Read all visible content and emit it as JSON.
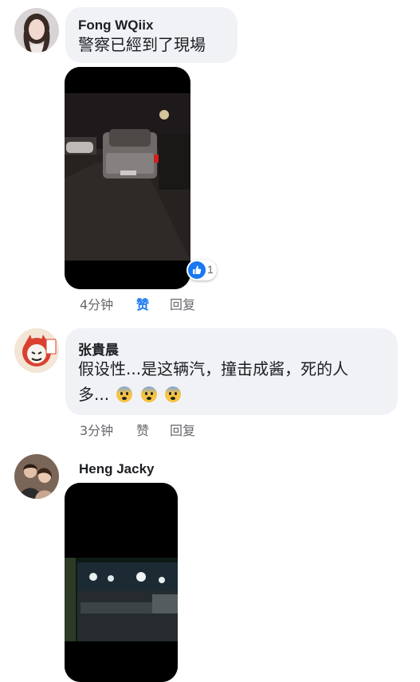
{
  "comments": [
    {
      "author": "Fong WQiix",
      "text": "警察已經到了現場",
      "time": "4分钟",
      "like_label": "赞",
      "reply_label": "回复",
      "reaction_count": "1",
      "reaction_icon": "like-icon",
      "media": "video-thumbnail-car-night"
    },
    {
      "author": "张貴晨",
      "text_line1": "假设性...是这辆汽，撞击成酱，死的人",
      "text_line2": "多...",
      "emoji": "fearful-face-icon",
      "time": "3分钟",
      "like_label": "赞",
      "reply_label": "回复"
    },
    {
      "author": "Heng Jacky",
      "media": "video-thumbnail-street-night"
    }
  ],
  "colors": {
    "bubble": "#f0f2f5",
    "meta": "#65676b",
    "like_active": "#1877f2"
  }
}
